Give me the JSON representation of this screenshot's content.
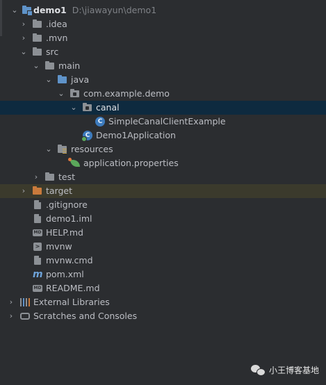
{
  "project_tree": {
    "root": {
      "name": "demo1",
      "path": "D:\\jiawayun\\demo1"
    },
    "items": [
      {
        "label": ".idea"
      },
      {
        "label": ".mvn"
      },
      {
        "label": "src"
      },
      {
        "label": "main"
      },
      {
        "label": "java"
      },
      {
        "label": "com.example.demo"
      },
      {
        "label": "canal"
      },
      {
        "label": "SimpleCanalClientExample"
      },
      {
        "label": "Demo1Application"
      },
      {
        "label": "resources"
      },
      {
        "label": "application.properties"
      },
      {
        "label": "test"
      },
      {
        "label": "target"
      },
      {
        "label": ".gitignore"
      },
      {
        "label": "demo1.iml"
      },
      {
        "label": "HELP.md"
      },
      {
        "label": "mvnw"
      },
      {
        "label": "mvnw.cmd"
      },
      {
        "label": "pom.xml"
      },
      {
        "label": "README.md"
      },
      {
        "label": "External Libraries"
      },
      {
        "label": "Scratches and Consoles"
      }
    ]
  },
  "icons": {
    "class_letter": "C",
    "md_badge": "MD",
    "term_badge": ">",
    "maven_letter": "m"
  },
  "watermark": {
    "text": "小王博客基地"
  },
  "colors": {
    "background": "#2b2d30",
    "selected_row": "#0e2a3f",
    "target_row": "#3b3a2c",
    "folder_blue": "#5f93c9",
    "folder_orange": "#c97a3c"
  }
}
